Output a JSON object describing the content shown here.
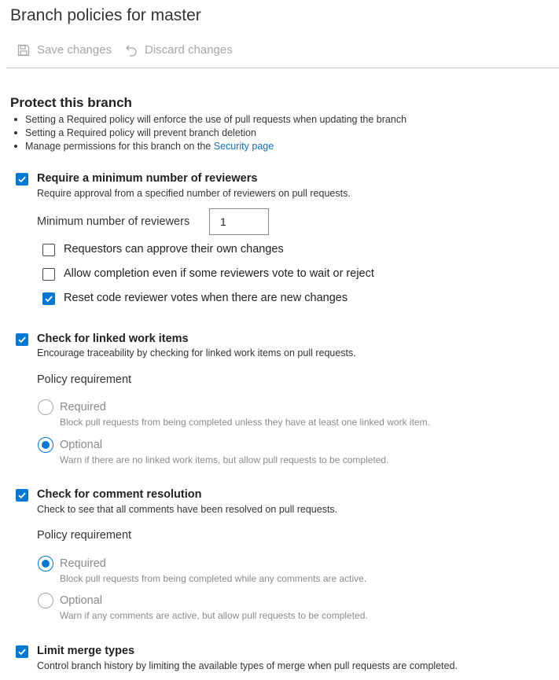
{
  "page": {
    "title": "Branch policies for master"
  },
  "toolbar": {
    "save_label": "Save changes",
    "discard_label": "Discard changes"
  },
  "protect": {
    "title": "Protect this branch",
    "bullets": [
      "Setting a Required policy will enforce the use of pull requests when updating the branch",
      "Setting a Required policy will prevent branch deletion",
      "Manage permissions for this branch on the "
    ],
    "security_link": "Security page"
  },
  "min_reviewers": {
    "title": "Require a minimum number of reviewers",
    "description": "Require approval from a specified number of reviewers on pull requests.",
    "checked": true,
    "count_label": "Minimum number of reviewers",
    "count_value": "1",
    "options": [
      {
        "label": "Requestors can approve their own changes",
        "checked": false
      },
      {
        "label": "Allow completion even if some reviewers vote to wait or reject",
        "checked": false
      },
      {
        "label": "Reset code reviewer votes when there are new changes",
        "checked": true
      }
    ]
  },
  "linked_work_items": {
    "title": "Check for linked work items",
    "description": "Encourage traceability by checking for linked work items on pull requests.",
    "checked": true,
    "requirement_label": "Policy requirement",
    "options": [
      {
        "label": "Required",
        "desc": "Block pull requests from being completed unless they have at least one linked work item.",
        "selected": false
      },
      {
        "label": "Optional",
        "desc": "Warn if there are no linked work items, but allow pull requests to be completed.",
        "selected": true
      }
    ]
  },
  "comment_resolution": {
    "title": "Check for comment resolution",
    "description": "Check to see that all comments have been resolved on pull requests.",
    "checked": true,
    "requirement_label": "Policy requirement",
    "options": [
      {
        "label": "Required",
        "desc": "Block pull requests from being completed while any comments are active.",
        "selected": true
      },
      {
        "label": "Optional",
        "desc": "Warn if any comments are active, but allow pull requests to be completed.",
        "selected": false
      }
    ]
  },
  "merge_types": {
    "title": "Limit merge types",
    "description": "Control branch history by limiting the available types of merge when pull requests are completed.",
    "checked": true
  },
  "colors": {
    "accent": "#0078d4",
    "link": "#106ebe",
    "disabled": "#a6a6a6"
  }
}
